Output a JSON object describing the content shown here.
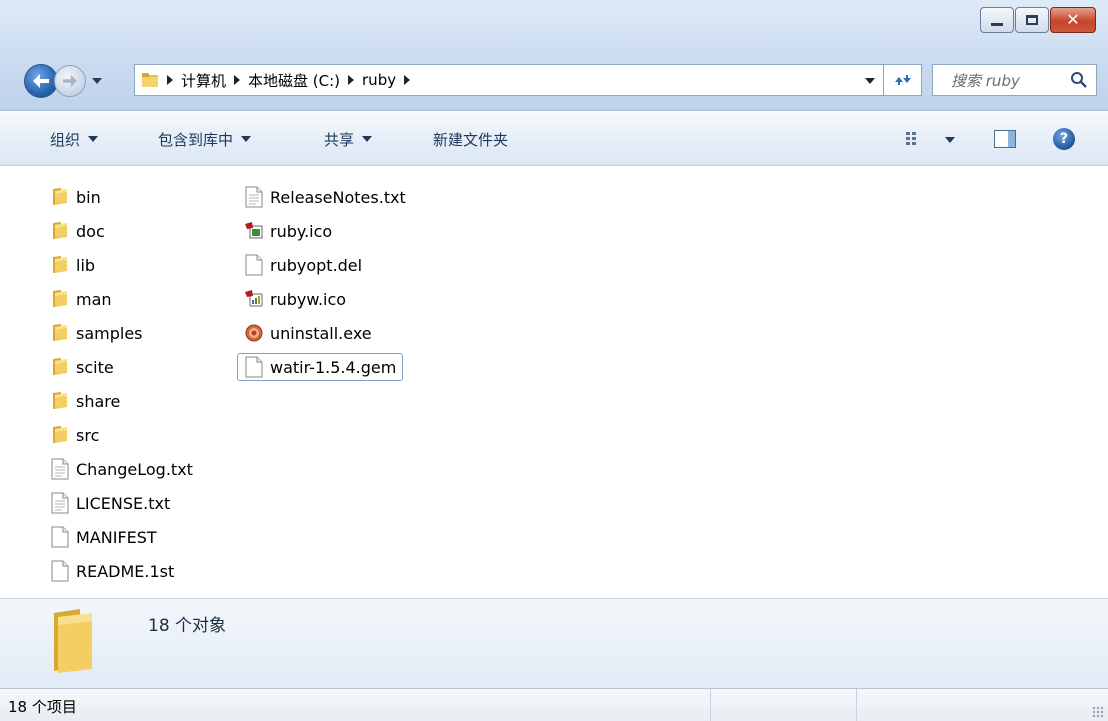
{
  "window": {
    "controls": {
      "minimize": "minimize-icon",
      "maximize": "maximize-icon",
      "close": "close-icon"
    }
  },
  "address": {
    "crumbs": [
      "计算机",
      "本地磁盘 (C:)",
      "ruby"
    ]
  },
  "search": {
    "placeholder": "搜索 ruby"
  },
  "toolbar": {
    "organize": "组织",
    "include_in_library": "包含到库中",
    "share": "共享",
    "new_folder": "新建文件夹"
  },
  "files": {
    "column1": [
      {
        "name": "bin",
        "icon": "folder-icon"
      },
      {
        "name": "doc",
        "icon": "folder-icon"
      },
      {
        "name": "lib",
        "icon": "folder-icon"
      },
      {
        "name": "man",
        "icon": "folder-icon"
      },
      {
        "name": "samples",
        "icon": "folder-icon"
      },
      {
        "name": "scite",
        "icon": "folder-icon"
      },
      {
        "name": "share",
        "icon": "folder-icon"
      },
      {
        "name": "src",
        "icon": "folder-icon"
      },
      {
        "name": "ChangeLog.txt",
        "icon": "text-file-icon"
      },
      {
        "name": "LICENSE.txt",
        "icon": "text-file-icon"
      },
      {
        "name": "MANIFEST",
        "icon": "blank-file-icon"
      },
      {
        "name": "README.1st",
        "icon": "blank-file-icon"
      }
    ],
    "column2": [
      {
        "name": "ReleaseNotes.txt",
        "icon": "text-file-icon"
      },
      {
        "name": "ruby.ico",
        "icon": "ruby-icon-file-icon"
      },
      {
        "name": "rubyopt.del",
        "icon": "blank-file-icon"
      },
      {
        "name": "rubyw.ico",
        "icon": "rubyw-icon-file-icon"
      },
      {
        "name": "uninstall.exe",
        "icon": "installer-icon"
      },
      {
        "name": "watir-1.5.4.gem",
        "icon": "blank-file-icon",
        "selected": true
      }
    ]
  },
  "details": {
    "summary": "18 个对象"
  },
  "status": {
    "text": "18 个项目"
  }
}
